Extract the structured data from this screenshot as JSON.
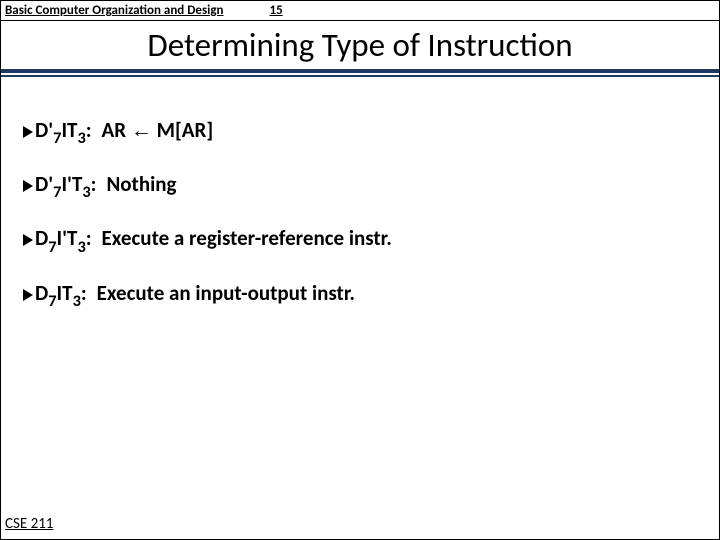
{
  "header": {
    "course": "Basic Computer Organization and Design",
    "page": "15"
  },
  "title": "Determining Type of Instruction",
  "bullets": [
    {
      "D": "D'",
      "Dsub": "7",
      "I": "I",
      "T": "T",
      "Tsub": "3",
      "colon": ":",
      "desc_pre": "AR ",
      "arrow": "←",
      "desc_post": " M[AR]"
    },
    {
      "D": "D'",
      "Dsub": "7",
      "I": "I'",
      "T": "T",
      "Tsub": "3",
      "colon": ":",
      "desc": "Nothing"
    },
    {
      "D": "D",
      "Dsub": "7",
      "I": "I'",
      "T": "T",
      "Tsub": "3",
      "colon": ":",
      "desc": "Execute a register-reference instr."
    },
    {
      "D": "D",
      "Dsub": "7",
      "I": "I",
      "T": "T",
      "Tsub": "3",
      "colon": ":",
      "desc": " Execute an input-output instr."
    }
  ],
  "footer": "CSE 211"
}
